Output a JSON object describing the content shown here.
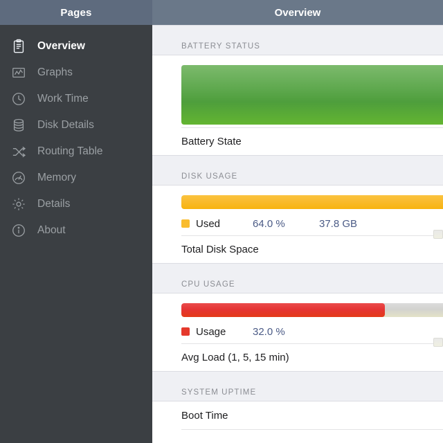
{
  "sidebar": {
    "header_title": "Pages",
    "items": [
      {
        "label": "Overview",
        "icon": "clipboard-icon",
        "active": true
      },
      {
        "label": "Graphs",
        "icon": "chart-graph-icon",
        "active": false
      },
      {
        "label": "Work Time",
        "icon": "clock-icon",
        "active": false
      },
      {
        "label": "Disk Details",
        "icon": "database-disk-icon",
        "active": false
      },
      {
        "label": "Routing Table",
        "icon": "shuffle-arrows-icon",
        "active": false
      },
      {
        "label": "Memory",
        "icon": "gauge-icon",
        "active": false
      },
      {
        "label": "Details",
        "icon": "gear-icon",
        "active": false
      },
      {
        "label": "About",
        "icon": "info-circle-icon",
        "active": false
      }
    ]
  },
  "main": {
    "header_title": "Overview",
    "sections": [
      {
        "title": "BATTERY STATUS",
        "bar": {
          "percent": 86,
          "color": "#4e9e3c"
        },
        "rows": [
          {
            "label": "Battery State"
          }
        ]
      },
      {
        "title": "DISK USAGE",
        "bar": {
          "percent": 91,
          "color": "#f9bc2e"
        },
        "legend": {
          "name": "Used",
          "percent": "64.0 %",
          "size": "37.8 GB",
          "swatch_color": "#f9bc2e"
        },
        "rows": [
          {
            "label": "Total Disk Space"
          }
        ]
      },
      {
        "title": "CPU USAGE",
        "bar": {
          "percent": 49,
          "color": "#e5392c"
        },
        "legend": {
          "name": "Usage",
          "percent": "32.0 %",
          "size": "",
          "swatch_color": "#e5392c"
        },
        "rows": [
          {
            "label": "Avg Load (1, 5, 15 min)"
          }
        ]
      },
      {
        "title": "SYSTEM UPTIME",
        "rows": [
          {
            "label": "Boot Time"
          }
        ]
      }
    ]
  },
  "colors": {
    "sidebar_bg": "#3b3f43",
    "sidebar_header_bg": "#5e6b7e",
    "main_header_bg": "#6a7889",
    "section_head_bg": "#eff0f4",
    "value_text": "#4b5b86"
  }
}
